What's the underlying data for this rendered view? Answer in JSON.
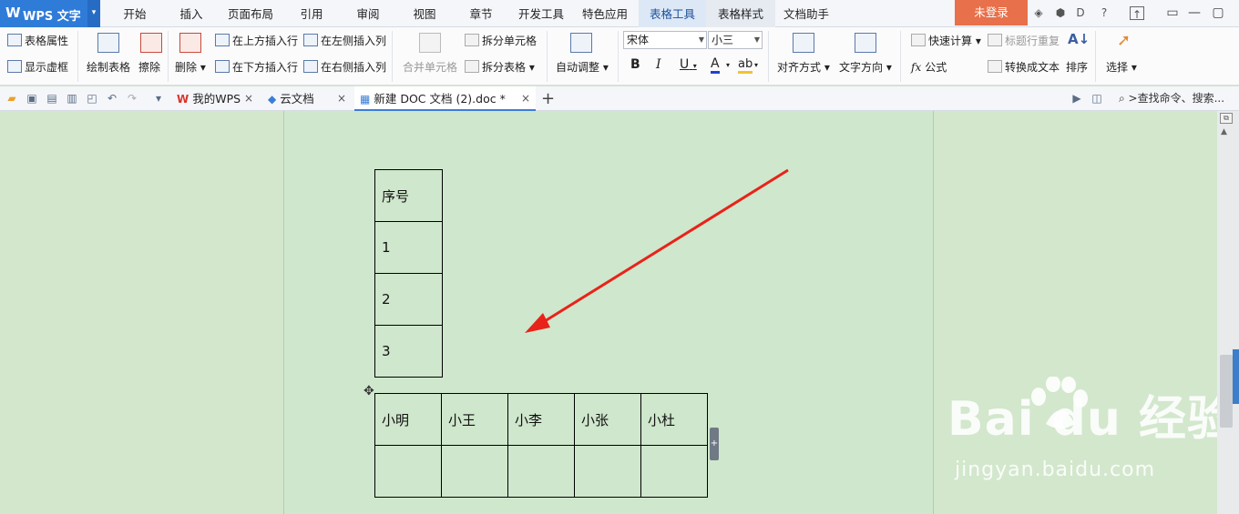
{
  "app": {
    "logo_glyph": "W",
    "name": "WPS 文字",
    "dropdown_glyph": "▾"
  },
  "menu": {
    "tabs": [
      "开始",
      "插入",
      "页面布局",
      "引用",
      "审阅",
      "视图",
      "章节",
      "开发工具",
      "特色应用",
      "表格工具",
      "表格样式",
      "文档助手"
    ],
    "active_tab": "表格工具",
    "login_label": "未登录"
  },
  "ribbon": {
    "table_props": "表格属性",
    "show_gridlines": "显示虚框",
    "draw_table": "绘制表格",
    "erase": "擦除",
    "delete": "删除",
    "insert_row_above": "在上方插入行",
    "insert_row_below": "在下方插入行",
    "insert_col_left": "在左侧插入列",
    "insert_col_right": "在右侧插入列",
    "merge_cells": "合并单元格",
    "split_cells": "拆分单元格",
    "split_table": "拆分表格",
    "auto_adjust": "自动调整",
    "font_name": "宋体",
    "font_size": "小三",
    "bold": "B",
    "italic": "I",
    "underline": "U",
    "font_color": "A",
    "highlight": "ab",
    "alignment": "对齐方式",
    "text_direction": "文字方向",
    "quick_calc": "快速计算",
    "repeat_header": "标题行重复",
    "formula": "公式",
    "convert_to_text": "转换成文本",
    "sort": "排序",
    "select": "选择"
  },
  "doc_tabs": [
    {
      "label": "我的WPS",
      "icon": "wps-icon"
    },
    {
      "label": "云文档",
      "icon": "cloud-cube-icon"
    },
    {
      "label": "新建 DOC 文档 (2).doc *",
      "icon": "doc-icon",
      "active": true
    }
  ],
  "search_command": ">查找命令、搜索...",
  "tables": {
    "table1": [
      [
        "序号"
      ],
      [
        "1"
      ],
      [
        "2"
      ],
      [
        "3"
      ]
    ],
    "table2": [
      [
        "小明",
        "小王",
        "小李",
        "小张",
        "小杜"
      ],
      [
        "",
        "",
        "",
        "",
        ""
      ]
    ]
  },
  "annotation_arrow_color": "#e8231a",
  "watermark": {
    "logo": "Bai  du 经验",
    "url": "jingyan.baidu.com"
  },
  "colors": {
    "accent": "#2f7bd8",
    "login": "#e8704a",
    "page_bg": "#cfe7cc"
  }
}
